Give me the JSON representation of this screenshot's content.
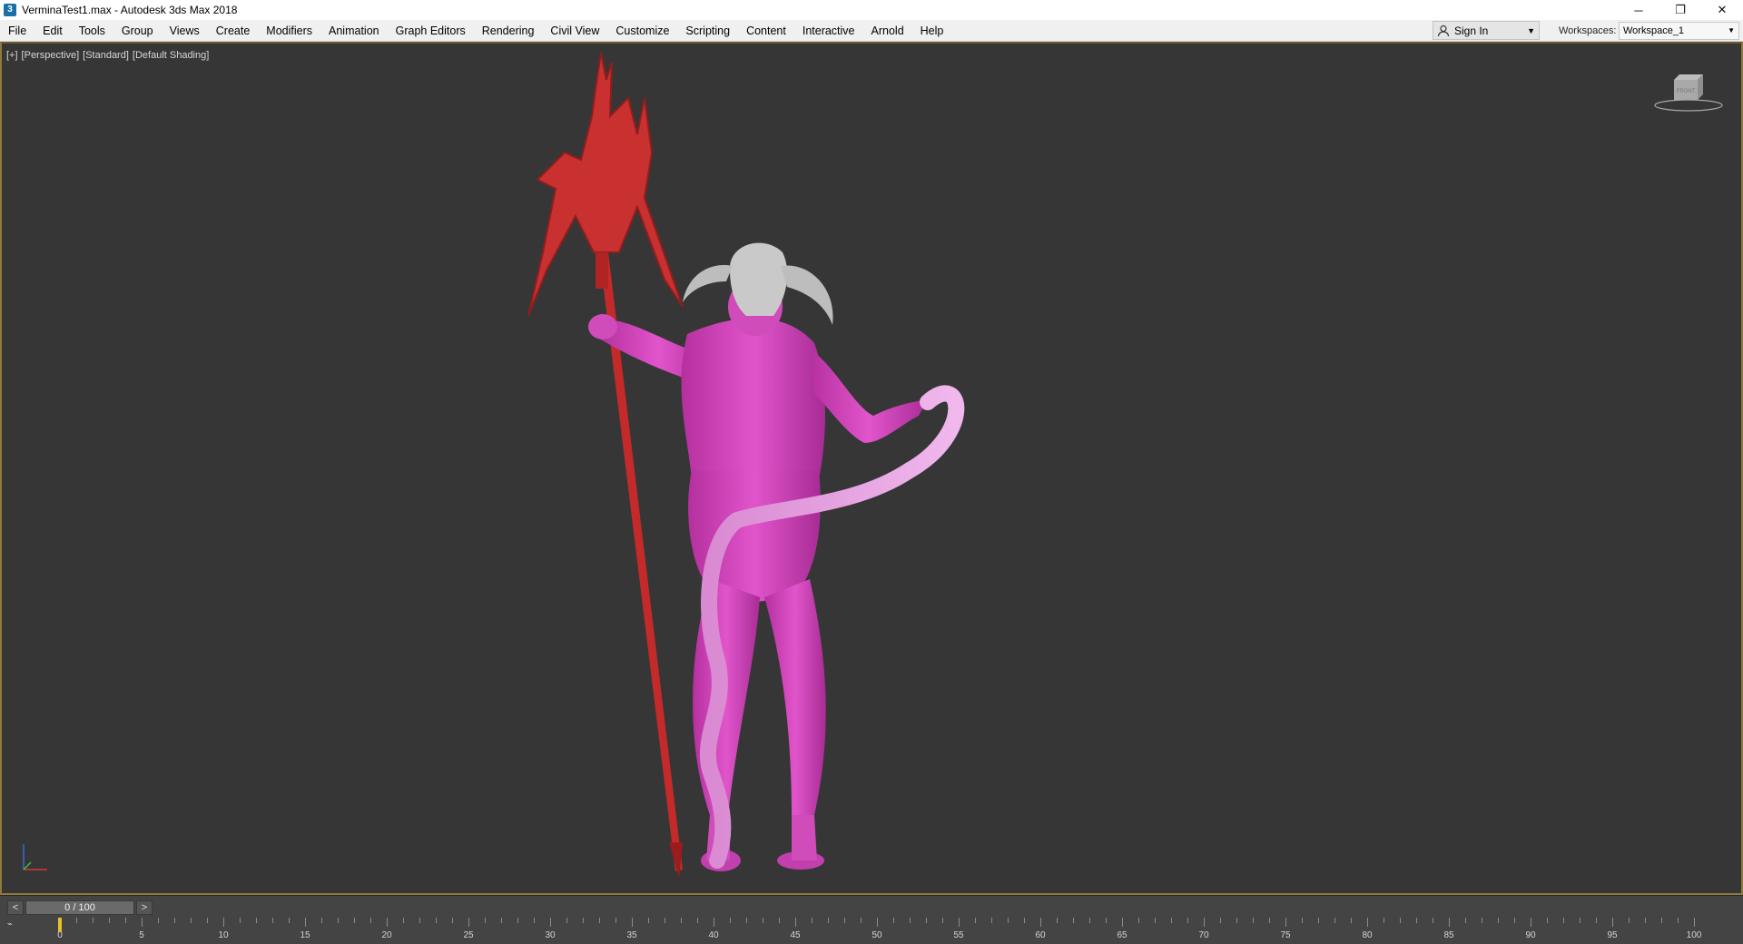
{
  "window": {
    "title": "VerminaTest1.max - Autodesk 3ds Max 2018",
    "app_icon": "3ds-max-icon",
    "controls": {
      "minimize": "─",
      "restore": "❐",
      "close": "✕"
    }
  },
  "menubar": {
    "items": [
      "File",
      "Edit",
      "Tools",
      "Group",
      "Views",
      "Create",
      "Modifiers",
      "Animation",
      "Graph Editors",
      "Rendering",
      "Civil View",
      "Customize",
      "Scripting",
      "Content",
      "Interactive",
      "Arnold",
      "Help"
    ],
    "sign_in": "Sign In",
    "workspaces_label": "Workspaces:",
    "workspace_value": "Workspace_1"
  },
  "viewport": {
    "labels": [
      "[+]",
      "[Perspective]",
      "[Standard]",
      "[Default Shading]"
    ],
    "viewcube_face": "FRONT",
    "colors": {
      "background": "#363636",
      "skin": "#d63fbe",
      "tail": "#e6a0e0",
      "horns": "#c8c8c8",
      "weapon": "#c42a2a",
      "border": "#8e7a3c"
    }
  },
  "timeline": {
    "prev": "<",
    "frame_readout": "0 / 100",
    "next": ">",
    "current_frame": 0,
    "total_frames": 100,
    "tick_labels": [
      "0",
      "5",
      "10",
      "15",
      "20",
      "25",
      "30",
      "35",
      "40",
      "45",
      "50",
      "55",
      "60",
      "65",
      "70",
      "75",
      "80",
      "85",
      "90",
      "95",
      "100"
    ]
  }
}
